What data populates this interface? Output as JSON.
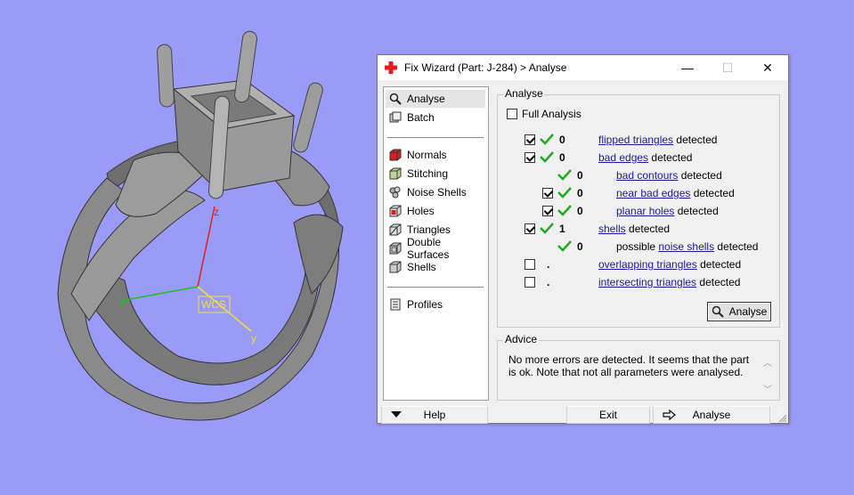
{
  "viewport": {
    "axes": {
      "z": "z",
      "x": "x",
      "y": "y",
      "origin_label": "WCS"
    },
    "colors": {
      "background": "#9a9af7",
      "model": "#8c8c8c",
      "z_axis": "#e02020",
      "x_axis": "#20c020",
      "y_axis": "#f0e040"
    }
  },
  "dialog": {
    "title": "Fix Wizard (Part: J-284) > Analyse",
    "app_icon": "red-cross-icon",
    "window_buttons": {
      "minimize": "—",
      "maximize": "☐",
      "close": "✕"
    }
  },
  "nav": {
    "group1": [
      {
        "label": "Analyse",
        "icon": "magnifier-icon",
        "selected": true
      },
      {
        "label": "Batch",
        "icon": "batch-icon"
      }
    ],
    "group2": [
      {
        "label": "Normals",
        "icon": "normals-cube-icon"
      },
      {
        "label": "Stitching",
        "icon": "stitching-cube-icon"
      },
      {
        "label": "Noise Shells",
        "icon": "noise-shells-icon"
      },
      {
        "label": "Holes",
        "icon": "holes-cube-icon"
      },
      {
        "label": "Triangles",
        "icon": "triangles-cube-icon"
      },
      {
        "label": "Double Surfaces",
        "icon": "double-surfaces-icon"
      },
      {
        "label": "Shells",
        "icon": "shells-cube-icon"
      }
    ],
    "group3": [
      {
        "label": "Profiles",
        "icon": "profiles-icon"
      }
    ]
  },
  "analyse": {
    "legend": "Analyse",
    "full_analysis_label": "Full Analysis",
    "full_analysis_checked": false,
    "rows": [
      {
        "checked": true,
        "ok": true,
        "count": "0",
        "link": "flipped triangles",
        "suffix": " detected"
      },
      {
        "checked": true,
        "ok": true,
        "count": "0",
        "link": "bad edges",
        "suffix": " detected"
      },
      {
        "ok": true,
        "count": "0",
        "link": "bad contours",
        "suffix": " detected"
      },
      {
        "checked": true,
        "ok": true,
        "count": "0",
        "link": "near bad edges",
        "suffix": " detected"
      },
      {
        "checked": true,
        "ok": true,
        "count": "0",
        "link": "planar holes",
        "suffix": " detected"
      },
      {
        "checked": true,
        "ok": true,
        "count": "1",
        "link": "shells",
        "suffix": " detected"
      },
      {
        "ok": true,
        "count": "0",
        "prefix": "possible ",
        "link": "noise shells",
        "suffix": " detected"
      },
      {
        "checked": false,
        "count": ".",
        "link": "overlapping triangles",
        "suffix": " detected"
      },
      {
        "checked": false,
        "count": ".",
        "link": "intersecting triangles",
        "suffix": " detected"
      }
    ],
    "button_label": "Analyse"
  },
  "advice": {
    "legend": "Advice",
    "text": "No more errors are detected. It seems that the part is ok. Note that not all parameters were analysed."
  },
  "bottom": {
    "help_label": "Help",
    "exit_label": "Exit",
    "analyse_label": "Analyse"
  }
}
